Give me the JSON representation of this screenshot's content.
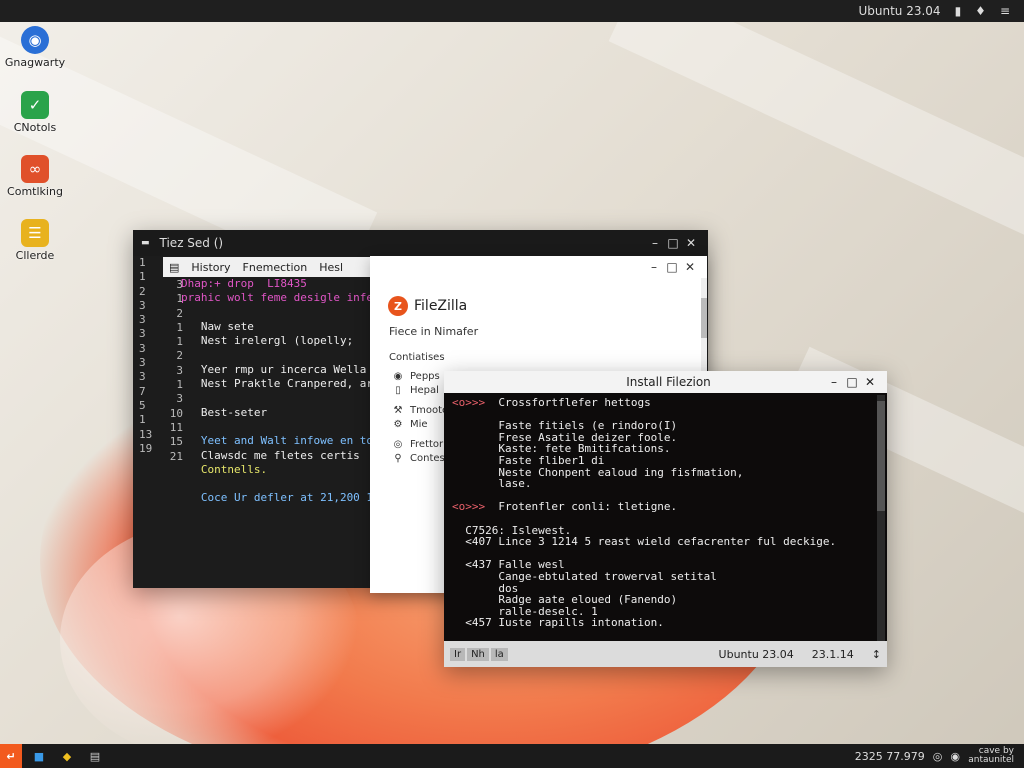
{
  "topbar": {
    "clock": "Ubuntu 23.04",
    "icons": [
      "screen-icon",
      "shield-icon",
      "power-icon"
    ]
  },
  "desktop": {
    "icons": [
      {
        "label": "Gnagwarty",
        "icon": "globe-icon",
        "color": "#2a6fd6"
      },
      {
        "label": "CNotols",
        "icon": "terminal-icon",
        "color": "#2aa34a"
      },
      {
        "label": "Comtlking",
        "icon": "code-icon",
        "color": "#e0502a"
      },
      {
        "label": "Cllerde",
        "icon": "document-icon",
        "color": "#e8b21e"
      }
    ]
  },
  "editor": {
    "title": "Tiez Sed ()",
    "menu": [
      "History",
      "Fnemection",
      "Hesl"
    ],
    "gutter": [
      "1",
      "1",
      "2",
      "3",
      "3",
      "3",
      "3",
      "3",
      "3",
      "7",
      "5",
      "1",
      "13",
      "19"
    ],
    "gutter2": [
      "3",
      "1",
      "2",
      "1",
      "1",
      "2",
      "3",
      "1",
      "3",
      "10",
      "11",
      "15",
      "21"
    ],
    "lines": [
      {
        "text": "Dhap:+ drop  LI8435",
        "color": "#e056c6"
      },
      {
        "text": "prahic wolt feme desigle infer",
        "color": "#e056c6"
      },
      {
        "text": "",
        "color": "#eee"
      },
      {
        "text": "   Naw sete",
        "color": "#eee"
      },
      {
        "text": "   Nest irelergl (lopelly;",
        "color": "#eee"
      },
      {
        "text": "",
        "color": "#eee"
      },
      {
        "text": "   Yeer rmp ur incerca Wella",
        "color": "#eee"
      },
      {
        "text": "   Nest Praktle Cranpered, art",
        "color": "#eee"
      },
      {
        "text": "",
        "color": "#eee"
      },
      {
        "text": "   Best-seter",
        "color": "#eee"
      },
      {
        "text": "",
        "color": "#eee"
      },
      {
        "text": "   Yeet and Walt infowe en to",
        "color": "#7ec0ff"
      },
      {
        "text": "   Clawsdc me fletes certis",
        "color": "#eee"
      },
      {
        "text": "   Contnells.",
        "color": "#e6e66a"
      },
      {
        "text": "",
        "color": "#eee"
      },
      {
        "text": "   Coce Ur defler at 21,200 1",
        "color": "#7ec0ff"
      }
    ]
  },
  "filezilla": {
    "logo_text": "FileZilla",
    "subtitle": "Fiece in Nimafer",
    "section": "Contiatises",
    "items": [
      {
        "label": "Pepps",
        "icon": "package-icon"
      },
      {
        "label": "Hepal",
        "icon": "page-icon"
      },
      {
        "label": "Tmoote",
        "icon": "wrench-icon"
      },
      {
        "label": "Mie",
        "icon": "gear-icon"
      },
      {
        "label": "Frettor",
        "icon": "globe-icon"
      },
      {
        "label": "Contest",
        "icon": "search-icon"
      }
    ]
  },
  "terminal": {
    "title": "Install Filezion",
    "lines": [
      {
        "prompt": "<o>>>",
        "text": "  Crossfortflefer hettogs"
      },
      {
        "prompt": "",
        "text": ""
      },
      {
        "prompt": "",
        "text": "       Faste fitiels (e rindoro(I)"
      },
      {
        "prompt": "",
        "text": "       Frese Asatile deizer foole."
      },
      {
        "prompt": "",
        "text": "       Kaste: fete Bmitifcations."
      },
      {
        "prompt": "",
        "text": "       Faste fliber1 di"
      },
      {
        "prompt": "",
        "text": "       Neste Chonpent ealoud ing fisfmation,"
      },
      {
        "prompt": "",
        "text": "       lase."
      },
      {
        "prompt": "",
        "text": ""
      },
      {
        "prompt": "<o>>>",
        "text": "  Frotenfler conli: tletigne."
      },
      {
        "prompt": "",
        "text": ""
      },
      {
        "prompt": "",
        "text": "  C7526: Islewest."
      },
      {
        "prompt": "",
        "text": "  <407 Lince 3 1214 5 reast wield cefacrenter ful deckige."
      },
      {
        "prompt": "",
        "text": ""
      },
      {
        "prompt": "",
        "text": "  <437 Falle wesl"
      },
      {
        "prompt": "",
        "text": "       Cange-ebtulated trowerval setital"
      },
      {
        "prompt": "",
        "text": "       dos"
      },
      {
        "prompt": "",
        "text": "       Radge aate eloued (Fanendo)"
      },
      {
        "prompt": "",
        "text": "       ralle-deselc. 1"
      },
      {
        "prompt": "",
        "text": "  <457 Iuste rapills intonation."
      }
    ],
    "status_tabs": [
      "Ir",
      "Nh",
      "la"
    ],
    "status_left": "Ubuntu 23.04",
    "status_right": "23.1.14"
  },
  "taskbar": {
    "clock_text": "2325 77.979",
    "tray_small": "cave by antaunitel",
    "apps": [
      "file-icon",
      "window-icon"
    ]
  }
}
